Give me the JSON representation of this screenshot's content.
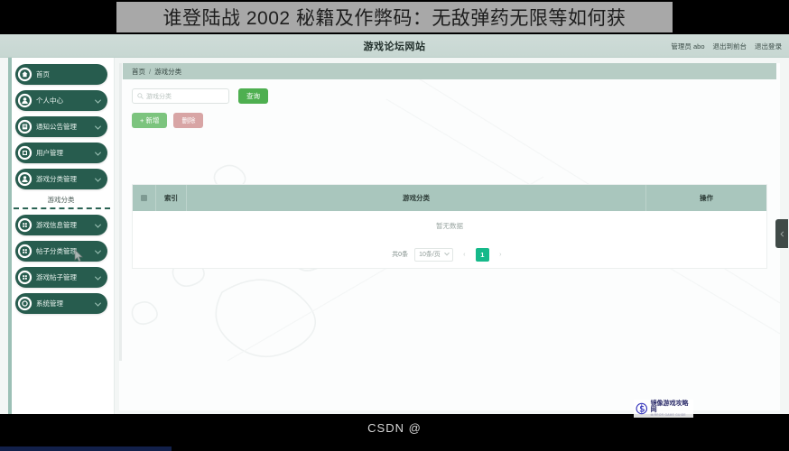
{
  "banner": {
    "title": "谁登陆战 2002 秘籍及作弊码：无敌弹药无限等如何获"
  },
  "appbar": {
    "site_title": "游戏论坛网站",
    "admin_label": "管理员 abo",
    "exit_front_label": "退出到前台",
    "logout_label": "退出登录"
  },
  "sidebar": {
    "items": [
      {
        "label": "首页",
        "icon": "home-icon",
        "caret": false
      },
      {
        "label": "个人中心",
        "icon": "user-icon",
        "caret": true
      },
      {
        "label": "通知公告管理",
        "icon": "notice-icon",
        "caret": true
      },
      {
        "label": "用户管理",
        "icon": "users-icon",
        "caret": true
      },
      {
        "label": "游戏分类管理",
        "icon": "category-icon",
        "caret": true
      },
      {
        "label": "游戏信息管理",
        "icon": "grid-icon",
        "caret": true
      },
      {
        "label": "帖子分类管理",
        "icon": "grid-icon",
        "caret": true
      },
      {
        "label": "游戏帖子管理",
        "icon": "grid-icon",
        "caret": true
      },
      {
        "label": "系统管理",
        "icon": "gear-icon",
        "caret": true
      }
    ],
    "submenu": {
      "label": "游戏分类"
    }
  },
  "breadcrumb": {
    "home": "首页",
    "separator": "/",
    "current": "游戏分类"
  },
  "toolbar": {
    "search_placeholder": "游戏分类",
    "search_value": "",
    "query_label": "查询",
    "add_label": "+ 新增",
    "delete_label": "删除"
  },
  "table": {
    "columns": {
      "index": "索引",
      "name": "游戏分类",
      "operation": "操作"
    },
    "empty_text": "暂无数据",
    "rows": []
  },
  "pagination": {
    "total_text": "共0条",
    "page_size_label": "10条/页",
    "prev_label": "‹",
    "next_label": "›",
    "current_page": "1"
  },
  "watermark": {
    "main": "镜像游戏攻略网",
    "sub": "MIRROR GAME GUIDE"
  },
  "footer": {
    "csdn": "CSDN @"
  },
  "colors": {
    "sidebar_item": "#275c4e",
    "header_bar": "#c7d7d2",
    "table_header": "#a9c6bd",
    "accent_green": "#4eaf50",
    "pager_active": "#16b98a",
    "delete_pink": "#d8a5a5"
  }
}
